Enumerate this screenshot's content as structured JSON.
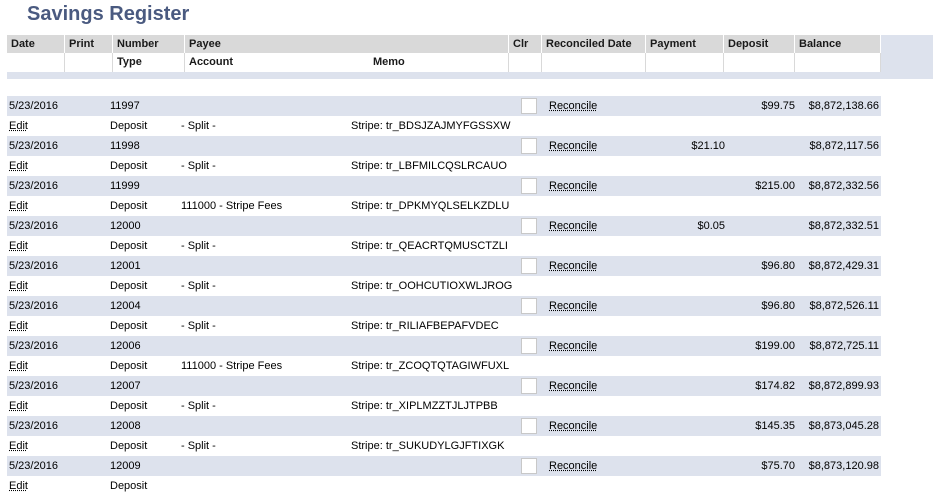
{
  "page_title": "Savings Register",
  "header": {
    "row1": [
      "Date",
      "Print",
      "Number",
      "Payee",
      "Clr",
      "Reconciled Date",
      "Payment",
      "Deposit",
      "Balance"
    ],
    "row2": [
      "Type",
      "Account",
      "Memo"
    ]
  },
  "transactions": [
    {
      "date": "5/23/2016",
      "number": "11997",
      "edit": "Edit",
      "type": "Deposit",
      "account": "- Split -",
      "memo": "Stripe: tr_BDSJZAJMYFGSSXW",
      "reconcile": "Reconcile",
      "payment": "",
      "deposit": "$99.75",
      "balance": "$8,872,138.66"
    },
    {
      "date": "5/23/2016",
      "number": "11998",
      "edit": "Edit",
      "type": "Deposit",
      "account": "- Split -",
      "memo": "Stripe: tr_LBFMILCQSLRCAUO",
      "reconcile": "Reconcile",
      "payment": "$21.10",
      "deposit": "",
      "balance": "$8,872,117.56"
    },
    {
      "date": "5/23/2016",
      "number": "11999",
      "edit": "Edit",
      "type": "Deposit",
      "account": "111000 - Stripe Fees",
      "memo": "Stripe: tr_DPKMYQLSELKZDLU",
      "reconcile": "Reconcile",
      "payment": "",
      "deposit": "$215.00",
      "balance": "$8,872,332.56"
    },
    {
      "date": "5/23/2016",
      "number": "12000",
      "edit": "Edit",
      "type": "Deposit",
      "account": "- Split -",
      "memo": "Stripe: tr_QEACRTQMUSCTZLI",
      "reconcile": "Reconcile",
      "payment": "$0.05",
      "deposit": "",
      "balance": "$8,872,332.51"
    },
    {
      "date": "5/23/2016",
      "number": "12001",
      "edit": "Edit",
      "type": "Deposit",
      "account": "- Split -",
      "memo": "Stripe: tr_OOHCUTIOXWLJROG",
      "reconcile": "Reconcile",
      "payment": "",
      "deposit": "$96.80",
      "balance": "$8,872,429.31"
    },
    {
      "date": "5/23/2016",
      "number": "12004",
      "edit": "Edit",
      "type": "Deposit",
      "account": "- Split -",
      "memo": "Stripe: tr_RILIAFBEPAFVDEC",
      "reconcile": "Reconcile",
      "payment": "",
      "deposit": "$96.80",
      "balance": "$8,872,526.11"
    },
    {
      "date": "5/23/2016",
      "number": "12006",
      "edit": "Edit",
      "type": "Deposit",
      "account": "111000 - Stripe Fees",
      "memo": "Stripe: tr_ZCOQTQTAGIWFUXL",
      "reconcile": "Reconcile",
      "payment": "",
      "deposit": "$199.00",
      "balance": "$8,872,725.11"
    },
    {
      "date": "5/23/2016",
      "number": "12007",
      "edit": "Edit",
      "type": "Deposit",
      "account": "- Split -",
      "memo": "Stripe: tr_XIPLMZZTJLJTPBB",
      "reconcile": "Reconcile",
      "payment": "",
      "deposit": "$174.82",
      "balance": "$8,872,899.93"
    },
    {
      "date": "5/23/2016",
      "number": "12008",
      "edit": "Edit",
      "type": "Deposit",
      "account": "- Split -",
      "memo": "Stripe: tr_SUKUDYLGJFTIXGK",
      "reconcile": "Reconcile",
      "payment": "",
      "deposit": "$145.35",
      "balance": "$8,873,045.28"
    },
    {
      "date": "5/23/2016",
      "number": "12009",
      "edit": "Edit",
      "type": "Deposit",
      "account": "",
      "memo": "",
      "reconcile": "Reconcile",
      "payment": "",
      "deposit": "$75.70",
      "balance": "$8,873,120.98"
    }
  ]
}
